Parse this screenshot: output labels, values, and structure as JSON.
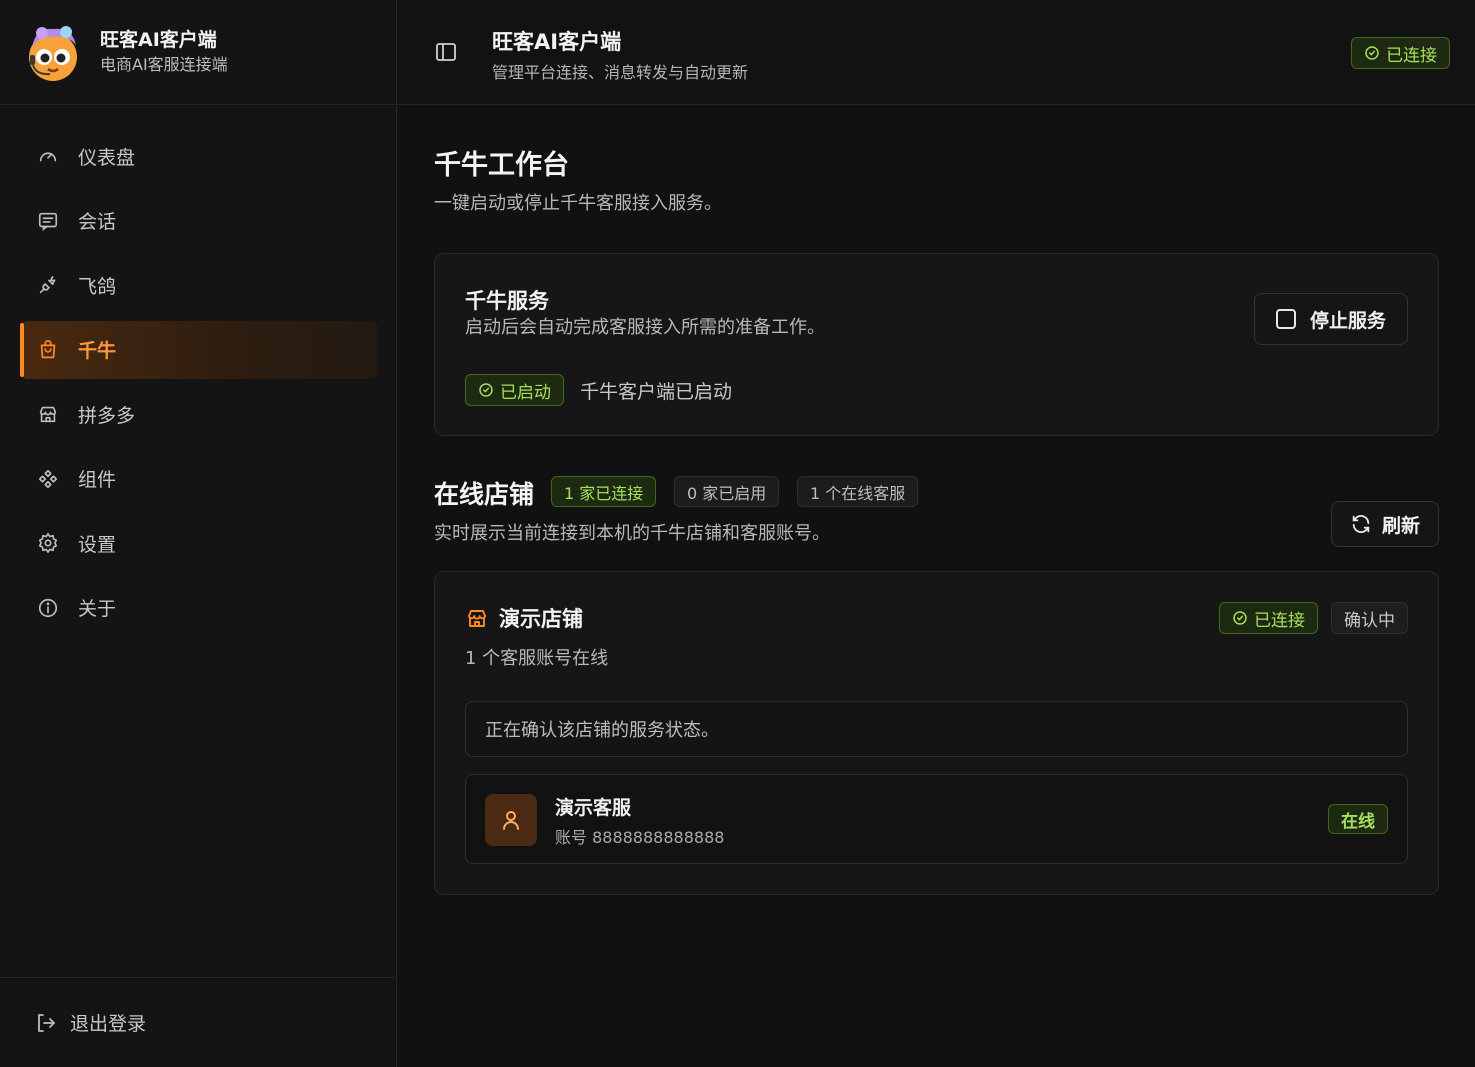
{
  "brand": {
    "title": "旺客AI客户端",
    "subtitle": "电商AI客服连接端"
  },
  "nav": {
    "items": [
      {
        "label": "仪表盘",
        "icon": "gauge-icon"
      },
      {
        "label": "会话",
        "icon": "message-icon"
      },
      {
        "label": "飞鸽",
        "icon": "plug-icon"
      },
      {
        "label": "千牛",
        "icon": "shopping-bag-icon",
        "active": true
      },
      {
        "label": "拼多多",
        "icon": "store-icon"
      },
      {
        "label": "组件",
        "icon": "component-icon"
      },
      {
        "label": "设置",
        "icon": "gear-icon"
      },
      {
        "label": "关于",
        "icon": "info-icon"
      }
    ],
    "logout": "退出登录"
  },
  "header": {
    "title": "旺客AI客户端",
    "subtitle": "管理平台连接、消息转发与自动更新",
    "status": "已连接"
  },
  "page": {
    "title": "千牛工作台",
    "subtitle": "一键启动或停止千牛客服接入服务。"
  },
  "service": {
    "title": "千牛服务",
    "subtitle": "启动后会自动完成客服接入所需的准备工作。",
    "stop_label": "停止服务",
    "status_badge": "已启动",
    "status_text": "千牛客户端已启动"
  },
  "shops": {
    "title": "在线店铺",
    "chip_connected": "1 家已连接",
    "chip_enabled": "0 家已启用",
    "chip_online": "1 个在线客服",
    "subtitle": "实时展示当前连接到本机的千牛店铺和客服账号。",
    "refresh_label": "刷新",
    "shop": {
      "name": "演示店铺",
      "subtitle": "1 个客服账号在线",
      "status_badge": "已连接",
      "confirm_badge": "确认中",
      "notice": "正在确认该店铺的服务状态。",
      "agent": {
        "name": "演示客服",
        "account": "账号 8888888888888",
        "status": "在线"
      }
    }
  },
  "colors": {
    "accent": "#ff8a24",
    "success": "#a6e05a",
    "background": "#111111"
  }
}
